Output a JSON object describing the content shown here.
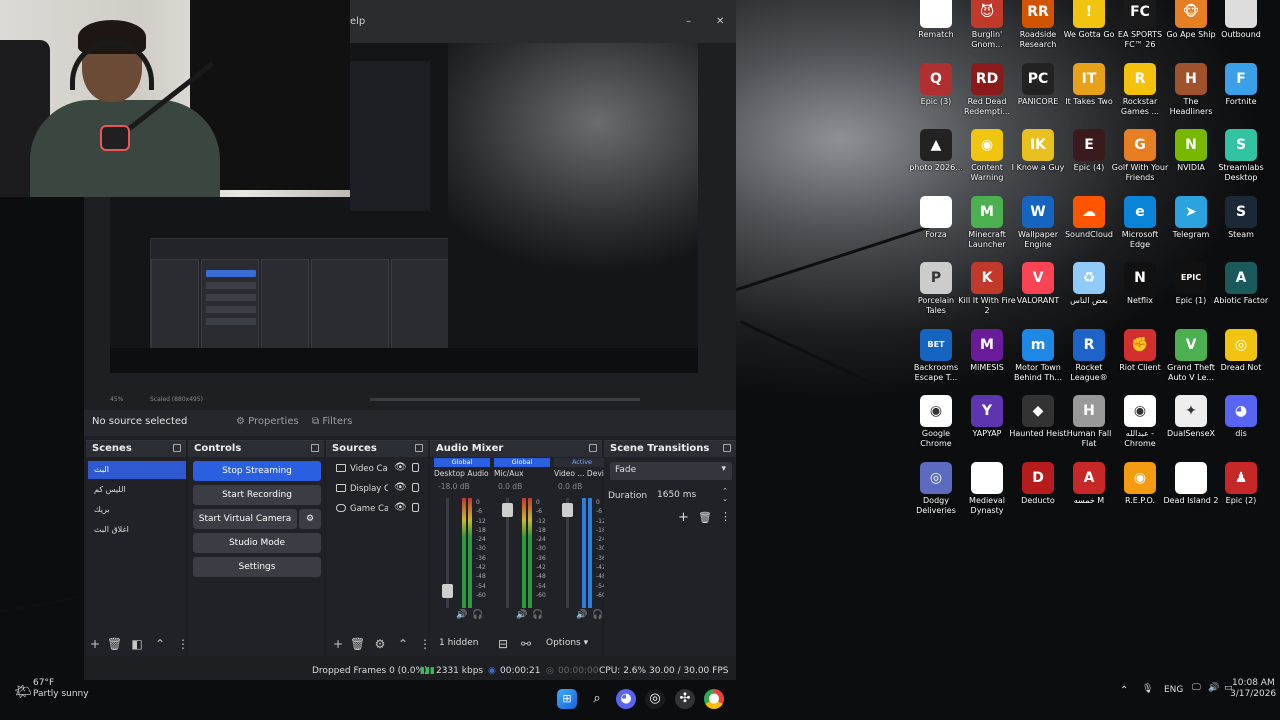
{
  "webcam": {
    "label": "webcam"
  },
  "obs": {
    "title_fragment": "elp",
    "preview": {
      "zoom_label": "45%",
      "scale_label": "Scaled (880x495)"
    },
    "context": {
      "no_source": "No source selected",
      "properties": "Properties",
      "filters": "Filters"
    },
    "scenes": {
      "title": "Scenes",
      "items": [
        "البث",
        "الليس كم",
        "بريك",
        "اغلاق البث"
      ]
    },
    "controls": {
      "title": "Controls",
      "stop_streaming": "Stop Streaming",
      "start_recording": "Start Recording",
      "start_virtual_camera": "Start Virtual Camera",
      "studio_mode": "Studio Mode",
      "settings": "Settings"
    },
    "sources": {
      "title": "Sources",
      "items": [
        "Video Cap",
        "Display Ca",
        "Game Cap"
      ]
    },
    "mixer": {
      "title": "Audio Mixer",
      "channels": [
        {
          "badge": "Global",
          "name": "Desktop Audio",
          "db": "-18.0 dB",
          "level": 0.1
        },
        {
          "badge": "Global",
          "name": "Mic/Aux",
          "db": "0.0 dB",
          "level": 0.95
        },
        {
          "badge": "Active",
          "name": "Video ... Devi",
          "db": "0.0 dB",
          "level": 0.95
        }
      ],
      "scale": [
        "0",
        "-6",
        "-12",
        "-18",
        "-24",
        "-30",
        "-36",
        "-42",
        "-48",
        "-54",
        "-60"
      ],
      "hidden_label": "1 hidden",
      "options_label": "Options"
    },
    "transitions": {
      "title": "Scene Transitions",
      "selected": "Fade",
      "duration_label": "Duration",
      "duration_value": "1650 ms"
    },
    "status": {
      "dropped": "Dropped Frames 0 (0.0%)",
      "bitrate": "2331 kbps",
      "live_time": "00:00:21",
      "rec_time": "00:00:00",
      "cpu": "CPU: 2.6%",
      "fps": "30.00 / 30.00 FPS"
    }
  },
  "desktop_icons": [
    {
      "label": "Rematch",
      "color": "#ffffff",
      "glyph": "",
      "icon": "file-icon"
    },
    {
      "label": "Burglin' Gnom...",
      "color": "#c0392b",
      "glyph": "😈",
      "icon": "game-icon"
    },
    {
      "label": "Roadside Research",
      "color": "#d35400",
      "glyph": "RR",
      "icon": "game-icon"
    },
    {
      "label": "We Gotta Go",
      "color": "#f1c40f",
      "glyph": "!",
      "icon": "game-icon"
    },
    {
      "label": "EA SPORTS FC™ 26",
      "color": "#1a1a1a",
      "glyph": "FC",
      "icon": "game-icon"
    },
    {
      "label": "Go Ape Ship",
      "color": "#e67e22",
      "glyph": "🐵",
      "icon": "game-icon"
    },
    {
      "label": "Outbound",
      "color": "#dddddd",
      "glyph": "",
      "icon": "file-icon"
    },
    {
      "label": "Epic (3)",
      "color": "#b03030",
      "glyph": "Q",
      "icon": "game-icon"
    },
    {
      "label": "Red Dead Redempti...",
      "color": "#8b1a1a",
      "glyph": "RD",
      "icon": "game-icon"
    },
    {
      "label": "PANICORE",
      "color": "#222222",
      "glyph": "PC",
      "icon": "game-icon"
    },
    {
      "label": "It Takes Two",
      "color": "#e8a21a",
      "glyph": "IT",
      "icon": "game-icon"
    },
    {
      "label": "Rockstar Games ...",
      "color": "#f4c20d",
      "glyph": "R",
      "icon": "rockstar-icon"
    },
    {
      "label": "The Headliners",
      "color": "#a0522d",
      "glyph": "H",
      "icon": "game-icon"
    },
    {
      "label": "Fortnite",
      "color": "#3aa0e8",
      "glyph": "F",
      "icon": "fortnite-icon"
    },
    {
      "label": "photo 2026...",
      "color": "#222222",
      "glyph": "▲",
      "icon": "photo-icon"
    },
    {
      "label": "Content Warning",
      "color": "#f1c40f",
      "glyph": "◉",
      "icon": "game-icon"
    },
    {
      "label": "I Know a Guy",
      "color": "#e8c020",
      "glyph": "IK",
      "icon": "game-icon"
    },
    {
      "label": "Epic (4)",
      "color": "#3a1a1a",
      "glyph": "E",
      "icon": "game-icon"
    },
    {
      "label": "Golf With Your Friends",
      "color": "#e67e22",
      "glyph": "G",
      "icon": "game-icon"
    },
    {
      "label": "NVIDIA",
      "color": "#76b900",
      "glyph": "N",
      "icon": "nvidia-icon"
    },
    {
      "label": "Streamlabs Desktop",
      "color": "#31c3a2",
      "glyph": "S",
      "icon": "streamlabs-icon"
    },
    {
      "label": "Forza",
      "color": "#ffffff",
      "glyph": "",
      "icon": "file-icon"
    },
    {
      "label": "Minecraft Launcher",
      "color": "#4caf50",
      "glyph": "M",
      "icon": "minecraft-icon"
    },
    {
      "label": "Wallpaper Engine",
      "color": "#1565c0",
      "glyph": "W",
      "icon": "wallpaper-icon"
    },
    {
      "label": "SoundCloud",
      "color": "#ff5500",
      "glyph": "☁",
      "icon": "soundcloud-icon"
    },
    {
      "label": "Microsoft Edge",
      "color": "#0a84d6",
      "glyph": "e",
      "icon": "edge-icon"
    },
    {
      "label": "Telegram",
      "color": "#2aa3de",
      "glyph": "➤",
      "icon": "telegram-icon"
    },
    {
      "label": "Steam",
      "color": "#1b2838",
      "glyph": "S",
      "icon": "steam-icon"
    },
    {
      "label": "Porcelain Tales",
      "color": "#cccccc",
      "glyph": "P",
      "icon": "game-icon"
    },
    {
      "label": "Kill It With Fire 2",
      "color": "#c0392b",
      "glyph": "K",
      "icon": "game-icon"
    },
    {
      "label": "VALORANT",
      "color": "#fa4454",
      "glyph": "V",
      "icon": "valorant-icon"
    },
    {
      "label": "بعض الناس",
      "color": "#90caf9",
      "glyph": "♻",
      "icon": "recycle-icon"
    },
    {
      "label": "Netflix",
      "color": "#111111",
      "glyph": "N",
      "icon": "netflix-icon"
    },
    {
      "label": "Epic (1)",
      "color": "#111111",
      "glyph": "EPIC",
      "icon": "epic-icon"
    },
    {
      "label": "Abiotic Factor",
      "color": "#1a5a5a",
      "glyph": "A",
      "icon": "game-icon"
    },
    {
      "label": "Backrooms Escape T...",
      "color": "#1565c0",
      "glyph": "BET",
      "icon": "game-icon"
    },
    {
      "label": "MiMESIS",
      "color": "#6a1b9a",
      "glyph": "M",
      "icon": "game-icon"
    },
    {
      "label": "Motor Town Behind Th...",
      "color": "#1e88e5",
      "glyph": "m",
      "icon": "game-icon"
    },
    {
      "label": "Rocket League®",
      "color": "#1e63c8",
      "glyph": "R",
      "icon": "game-icon"
    },
    {
      "label": "Riot Client",
      "color": "#d32f2f",
      "glyph": "✊",
      "icon": "riot-icon"
    },
    {
      "label": "Grand Theft Auto V Le...",
      "color": "#4caf50",
      "glyph": "V",
      "icon": "game-icon"
    },
    {
      "label": "Dread Not",
      "color": "#f1c40f",
      "glyph": "◎",
      "icon": "game-icon"
    },
    {
      "label": "Google Chrome",
      "color": "#ffffff",
      "glyph": "◉",
      "icon": "chrome-icon"
    },
    {
      "label": "YAPYAP",
      "color": "#5e35b1",
      "glyph": "Y",
      "icon": "game-icon"
    },
    {
      "label": "Haunted Heist",
      "color": "#333333",
      "glyph": "◆",
      "icon": "game-icon"
    },
    {
      "label": "Human Fall Flat",
      "color": "#999999",
      "glyph": "H",
      "icon": "game-icon"
    },
    {
      "label": "عبدالله - Chrome",
      "color": "#ffffff",
      "glyph": "◉",
      "icon": "chrome-icon"
    },
    {
      "label": "DualSenseX",
      "color": "#eeeeee",
      "glyph": "✦",
      "icon": "controller-icon"
    },
    {
      "label": "dis",
      "color": "#5865f2",
      "glyph": "◕",
      "icon": "discord-icon"
    },
    {
      "label": "Dodgy Deliveries",
      "color": "#5c6bc0",
      "glyph": "◎",
      "icon": "game-icon"
    },
    {
      "label": "Medieval Dynasty",
      "color": "#ffffff",
      "glyph": "",
      "icon": "file-icon"
    },
    {
      "label": "Deducto",
      "color": "#b71c1c",
      "glyph": "D",
      "icon": "game-icon"
    },
    {
      "label": "خمسه M",
      "color": "#c62828",
      "glyph": "A",
      "icon": "game-icon"
    },
    {
      "label": "R.E.P.O.",
      "color": "#f39c12",
      "glyph": "◉",
      "icon": "game-icon"
    },
    {
      "label": "Dead Island 2",
      "color": "#ffffff",
      "glyph": "",
      "icon": "file-icon"
    },
    {
      "label": "Epic (2)",
      "color": "#c62828",
      "glyph": "♟",
      "icon": "game-icon"
    }
  ],
  "taskbar": {
    "weather_temp": "67°F",
    "weather_desc": "Partly sunny",
    "lang": "ENG",
    "time": "10:08 AM",
    "date": "3/17/2026"
  }
}
